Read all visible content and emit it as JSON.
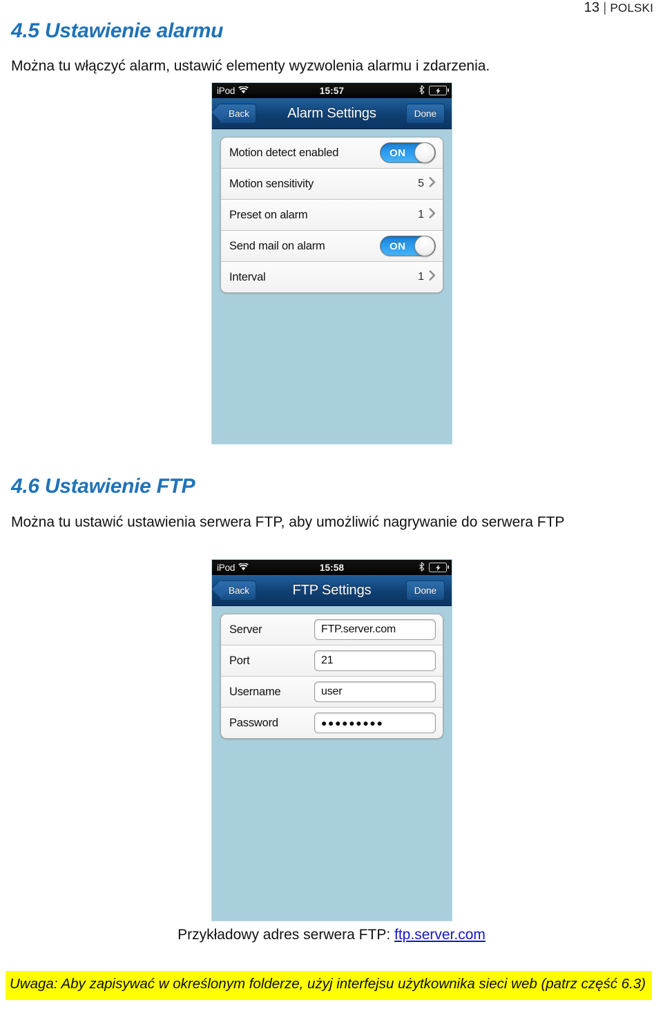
{
  "page_header": {
    "number": "13",
    "separator": "|",
    "language": "POLSKI"
  },
  "sections": {
    "alarm": {
      "heading": "4.5 Ustawienie alarmu",
      "paragraph": "Można tu włączyć alarm, ustawić elementy wyzwolenia alarmu i zdarzenia."
    },
    "ftp": {
      "heading": "4.6 Ustawienie FTP",
      "paragraph": "Można tu ustawić ustawienia serwera FTP, aby umożliwić nagrywanie do serwera FTP"
    }
  },
  "alarm_screenshot": {
    "status_bar": {
      "carrier": "iPod",
      "time": "15:57",
      "wifi_icon": "wifi-icon",
      "bluetooth_icon": "bluetooth-icon",
      "battery_icon": "battery-charging-icon"
    },
    "nav": {
      "back_label": "Back",
      "title": "Alarm Settings",
      "done_label": "Done"
    },
    "rows": [
      {
        "label": "Motion detect enabled",
        "control": "switch",
        "value": "ON"
      },
      {
        "label": "Motion sensitivity",
        "control": "disclosure",
        "value": "5"
      },
      {
        "label": "Preset on alarm",
        "control": "disclosure",
        "value": "1"
      },
      {
        "label": "Send mail on alarm",
        "control": "switch",
        "value": "ON"
      },
      {
        "label": "Interval",
        "control": "disclosure",
        "value": "1"
      }
    ]
  },
  "ftp_screenshot": {
    "status_bar": {
      "carrier": "iPod",
      "time": "15:58",
      "wifi_icon": "wifi-icon",
      "bluetooth_icon": "bluetooth-icon",
      "battery_icon": "battery-charging-icon"
    },
    "nav": {
      "back_label": "Back",
      "title": "FTP Settings",
      "done_label": "Done"
    },
    "rows": [
      {
        "label": "Server",
        "value": "FTP.server.com"
      },
      {
        "label": "Port",
        "value": "21"
      },
      {
        "label": "Username",
        "value": "user"
      },
      {
        "label": "Password",
        "value": "●●●●●●●●●"
      }
    ]
  },
  "caption": {
    "text": "Przykładowy adres serwera FTP: ",
    "link": "ftp.server.com"
  },
  "note": {
    "text": "Uwaga: Aby zapisywać w określonym folderze, użyj interfejsu użytkownika sieci web (patrz część 6.3)",
    "highlight_color": "#ffff00"
  },
  "colors": {
    "heading_blue": "#1f72b8",
    "link_blue": "#1515c8",
    "device_background": "#a9cedc",
    "nav_bar_blue": "#14477e",
    "switch_on_blue": "#2b9bee"
  }
}
